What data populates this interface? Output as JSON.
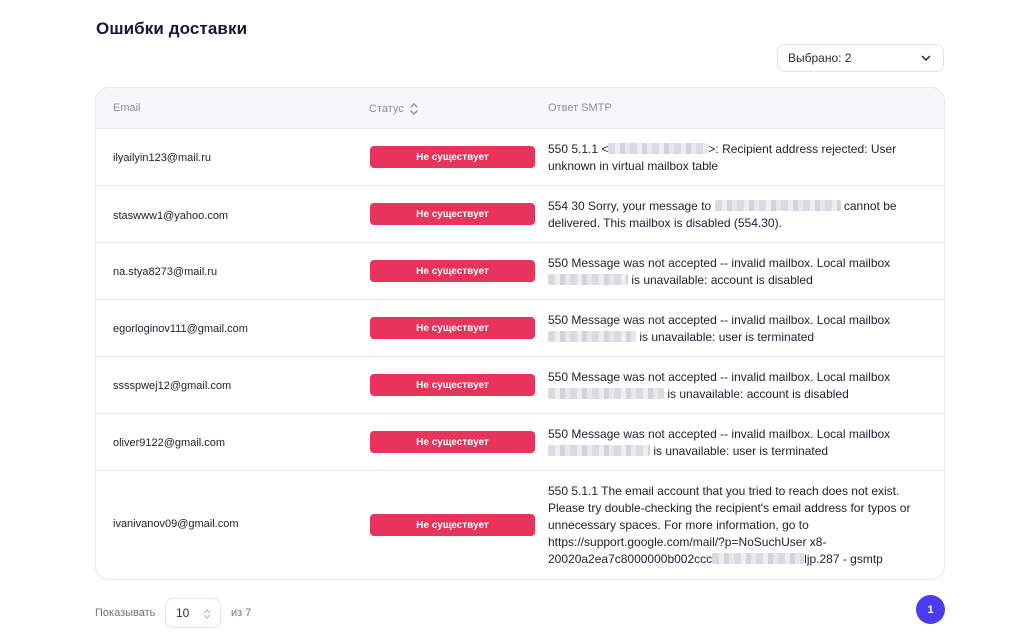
{
  "page": {
    "title": "Ошибки доставки"
  },
  "filter": {
    "selected_label": "Выбрано: 2"
  },
  "table": {
    "headers": {
      "email": "Email",
      "status": "Статус",
      "smtp": "Ответ SMTP"
    },
    "rows": [
      {
        "email": "ilyailyin123@mail.ru",
        "status": "Не существует",
        "smtp_before": "550 5.1.1 <",
        "smtp_after": ">: Recipient address rejected: User unknown in virtual mailbox table"
      },
      {
        "email": "staswww1@yahoo.com",
        "status": "Не существует",
        "smtp_before": "554 30 Sorry, your message to ",
        "smtp_after": " cannot be delivered. This mailbox is disabled (554.30)."
      },
      {
        "email": "na.stya8273@mail.ru",
        "status": "Не существует",
        "smtp_before": "550 Message was not accepted -- invalid mailbox. Local mailbox ",
        "smtp_after": " is unavailable: account is disabled"
      },
      {
        "email": "egorloginov111@gmail.com",
        "status": "Не существует",
        "smtp_before": "550 Message was not accepted -- invalid mailbox. Local mailbox ",
        "smtp_after": " is unavailable: user is terminated"
      },
      {
        "email": "sssspwej12@gmail.com",
        "status": "Не существует",
        "smtp_before": "550 Message was not accepted -- invalid mailbox. Local mailbox ",
        "smtp_after": " is unavailable: account is disabled"
      },
      {
        "email": "oliver9122@gmail.com",
        "status": "Не существует",
        "smtp_before": "550 Message was not accepted -- invalid mailbox. Local mailbox ",
        "smtp_after": " is unavailable: user is terminated"
      },
      {
        "email": "ivanivanov09@gmail.com",
        "status": "Не существует",
        "smtp_before": "550 5.1.1 The email account that you tried to reach does not exist. Please try double-checking the recipient's email address for typos or unnecessary spaces. For more information, go to https://support.google.com/mail/?p=NoSuchUser x8-20020a2ea7c8000000b002ccc",
        "smtp_after": "ljp.287 - gsmtp"
      }
    ]
  },
  "footer": {
    "show_label": "Показывать",
    "page_size": "10",
    "of_label": "из 7",
    "current_page": "1"
  },
  "colors": {
    "badge": "#e8345a",
    "accent": "#4a3cf0",
    "title": "#161634"
  },
  "icons": {
    "select": "chevron-down-icon",
    "sort": "sort-icon",
    "stepper": "stepper-icon"
  }
}
